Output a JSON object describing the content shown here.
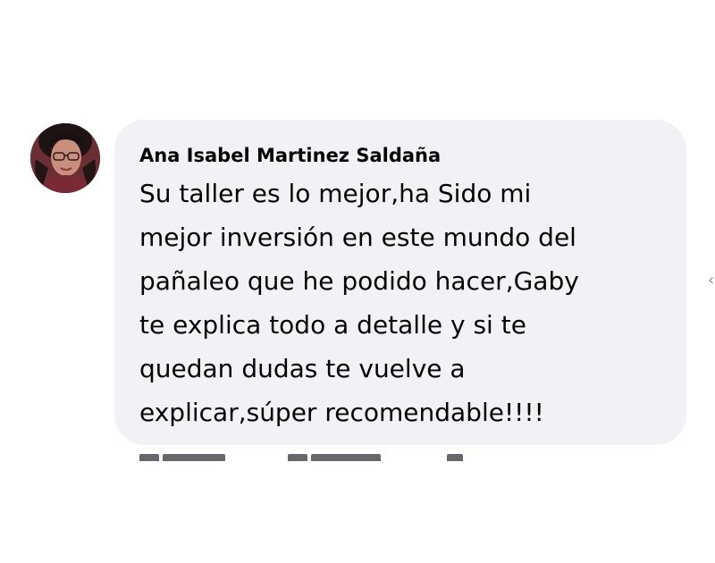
{
  "comment": {
    "author": "Ana Isabel Martinez Saldaña",
    "lines": [
      "Su taller es lo mejor,ha Sido mi",
      "mejor inversión en este mundo del",
      "pañaleo que he podido hacer,Gaby",
      "te explica todo a detalle y si te",
      "quedan dudas te vuelve a",
      "explicar,súper recomendable!!!!"
    ]
  },
  "colors": {
    "bubble_bg": "#f0f2f5",
    "text": "#050505",
    "action_text": "#65676b"
  },
  "icons": {
    "avatar": "user-avatar-photo",
    "side_arrow": "chevron-left-icon"
  }
}
